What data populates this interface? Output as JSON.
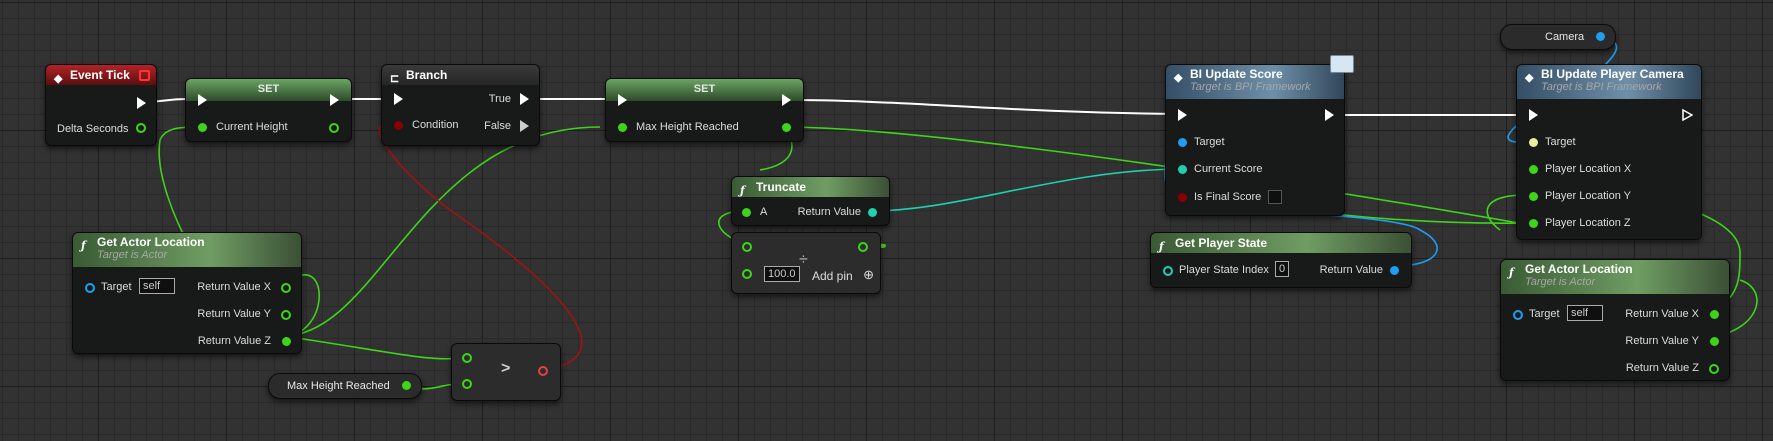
{
  "nodes": {
    "event_tick": {
      "title": "Event Tick",
      "delta_label": "Delta Seconds"
    },
    "set1": {
      "title": "SET",
      "var_label": "Current Height"
    },
    "branch": {
      "title": "Branch",
      "true_label": "True",
      "false_label": "False",
      "condition_label": "Condition"
    },
    "set2": {
      "title": "SET",
      "var_label": "Max Height Reached"
    },
    "truncate": {
      "title": "Truncate",
      "a_label": "A",
      "return_label": "Return Value"
    },
    "divide": {
      "value": "100.0",
      "op_symbol": "÷",
      "add_pin_label": "Add pin"
    },
    "get_actor_location1": {
      "title": "Get Actor Location",
      "subtitle": "Target is Actor",
      "target_label": "Target",
      "target_value": "self",
      "x_label": "Return Value X",
      "y_label": "Return Value Y",
      "z_label": "Return Value Z"
    },
    "max_height_var": {
      "label": "Max Height Reached"
    },
    "greater": {
      "op_symbol": ">"
    },
    "bi_update_score": {
      "title": "BI Update Score",
      "subtitle": "Target is BPI Framework",
      "target_label": "Target",
      "current_score_label": "Current Score",
      "is_final_label": "Is Final Score"
    },
    "get_player_state": {
      "title": "Get Player State",
      "index_label": "Player State Index",
      "index_value": "0",
      "return_label": "Return Value"
    },
    "camera_var": {
      "label": "Camera"
    },
    "bi_update_player_camera": {
      "title": "BI Update Player Camera",
      "subtitle": "Target is BPI Framework",
      "target_label": "Target",
      "x_label": "Player Location X",
      "y_label": "Player Location Y",
      "z_label": "Player Location Z"
    },
    "get_actor_location2": {
      "title": "Get Actor Location",
      "subtitle": "Target is Actor",
      "target_label": "Target",
      "target_value": "self",
      "x_label": "Return Value X",
      "y_label": "Return Value Y",
      "z_label": "Return Value Z"
    }
  },
  "colors": {
    "exec_wire": "#ffffff",
    "float_wire": "#3ed41a",
    "int_wire": "#1fd0b0",
    "object_wire": "#1e9ef2",
    "bool_wire": "#8a0000"
  },
  "icons": [
    "event-diamond-icon",
    "function-f-icon",
    "branch-icon",
    "interface-envelope-icon",
    "exec-pin-icon",
    "data-pin-icon"
  ]
}
